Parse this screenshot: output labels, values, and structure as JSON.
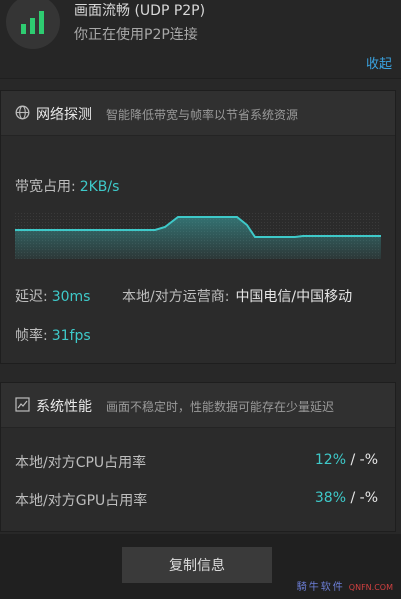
{
  "connection": {
    "title": "画面流畅 (UDP P2P)",
    "subtitle": "你正在使用P2P连接",
    "collapse": "收起",
    "signal_icon": "signal-bars-icon",
    "signal_color": "#2ecc71"
  },
  "network": {
    "title": "网络探测",
    "description": "智能降低带宽与帧率以节省系统资源",
    "icon": "globe-icon",
    "bandwidth_label": "带宽占用:",
    "bandwidth_value": "2KB/s",
    "latency_label": "延迟:",
    "latency_value": "30ms",
    "carrier_label": "本地/对方运营商:",
    "carrier_value": "中国电信/中国移动",
    "fps_label": "帧率:",
    "fps_value": "31fps",
    "graph_color": "#3ec9c9"
  },
  "performance": {
    "title": "系统性能",
    "description": "画面不稳定时，性能数据可能存在少量延迟",
    "icon": "chart-icon",
    "cpu_label": "本地/对方CPU占用率",
    "cpu_local": "12%",
    "cpu_remote": "/ -%",
    "gpu_label": "本地/对方GPU占用率",
    "gpu_local": "38%",
    "gpu_remote": "/ -%"
  },
  "footer": {
    "copy_button": "复制信息",
    "watermark_cn": "騎牛软件",
    "watermark_en": "QNFN.COM"
  }
}
